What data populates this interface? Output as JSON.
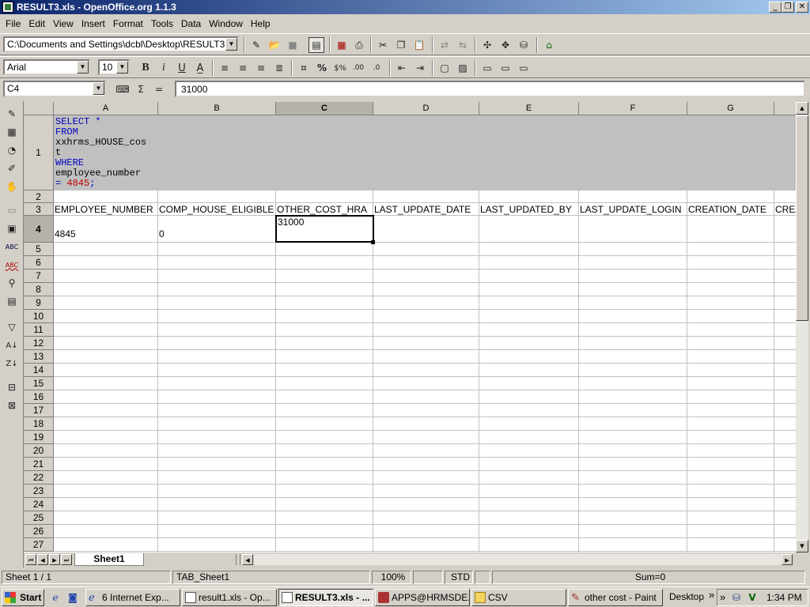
{
  "window": {
    "title": "RESULT3.xls - OpenOffice.org 1.1.3"
  },
  "menu": [
    "File",
    "Edit",
    "View",
    "Insert",
    "Format",
    "Tools",
    "Data",
    "Window",
    "Help"
  ],
  "toolbar": {
    "path": "C:\\Documents and Settings\\dcbl\\Desktop\\RESULT3"
  },
  "format": {
    "font": "Arial",
    "size": "10"
  },
  "formula": {
    "cell_ref": "C4",
    "sum_symbol": "Σ",
    "equals": "=",
    "content": "31000"
  },
  "columns": [
    "A",
    "B",
    "C",
    "D",
    "E",
    "F",
    "G"
  ],
  "rows": [
    "1",
    "2",
    "3",
    "4",
    "5",
    "6",
    "7",
    "8",
    "9",
    "10",
    "11",
    "12",
    "13",
    "14",
    "15",
    "16",
    "17",
    "18",
    "19",
    "20",
    "21",
    "22",
    "23",
    "24",
    "25",
    "26",
    "27"
  ],
  "sql": {
    "line1a": "SELECT ",
    "line1b": "*",
    "line2": "FROM",
    "line3": "xxhrms_HOUSE_cos",
    "line4": "t",
    "line5": "WHERE",
    "line6": "employee_number",
    "line7a": "= ",
    "line7b": "4845",
    "line7c": ";"
  },
  "headers_row3": [
    "EMPLOYEE_NUMBER",
    "COMP_HOUSE_ELIGIBLE",
    "OTHER_COST_HRA",
    "LAST_UPDATE_DATE",
    "LAST_UPDATED_BY",
    "LAST_UPDATE_LOGIN",
    "CREATION_DATE",
    "CREA"
  ],
  "row4": {
    "a": "4845",
    "b": "0",
    "c": "31000"
  },
  "sheet_tab": "Sheet1",
  "status": {
    "sheet": "Sheet 1 / 1",
    "page_style": "TAB_Sheet1",
    "zoom": "100%",
    "mode": "STD",
    "sum": "Sum=0"
  },
  "taskbar": {
    "start": "Start",
    "tasks": [
      "6 Internet Exp...",
      "result1.xls - Op...",
      "RESULT3.xls - ...",
      "APPS@HRMSDE...",
      "CSV",
      "other cost - Paint"
    ],
    "desktop": "Desktop",
    "chevrons": "»",
    "time": "1:34 PM"
  },
  "colors": {
    "titlebar": "#0a246a",
    "sql_keyword": "#0000c0",
    "sql_number": "#c00000",
    "sql_cell_bg": "#c0c0c0"
  }
}
